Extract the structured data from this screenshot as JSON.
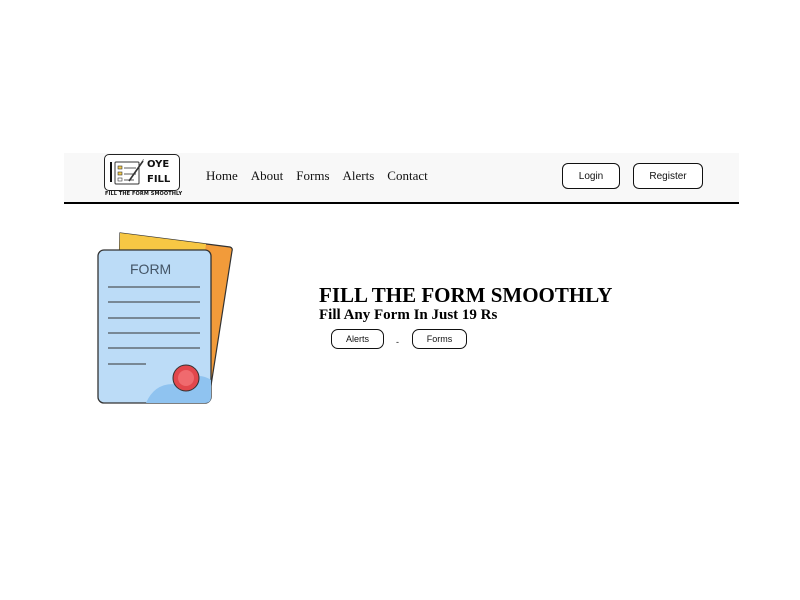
{
  "navbar": {
    "logo": {
      "line1": "OYE",
      "line2": "FILL",
      "tagline": "FILL THE FORM SMOOTHLY",
      "icon": "checklist-clipboard-icon"
    },
    "links": [
      {
        "label": "Home"
      },
      {
        "label": "About"
      },
      {
        "label": "Forms"
      },
      {
        "label": "Alerts"
      },
      {
        "label": "Contact"
      }
    ],
    "login_label": "Login",
    "register_label": "Register"
  },
  "hero": {
    "illustration": {
      "icon": "form-document-icon",
      "label": "FORM"
    },
    "title": "FILL THE FORM SMOOTHLY",
    "subtitle": "Fill Any Form In Just 19 Rs",
    "alerts_label": "Alerts",
    "separator": "-",
    "forms_label": "Forms"
  },
  "colors": {
    "navbar_bg": "#f8f8f8",
    "paper_back_orange": "#f29b3a",
    "paper_back_yellow": "#f7c744",
    "paper_front": "#bcdcf7",
    "paper_front_accent": "#8fc3f0",
    "seal": "#e2474c"
  }
}
